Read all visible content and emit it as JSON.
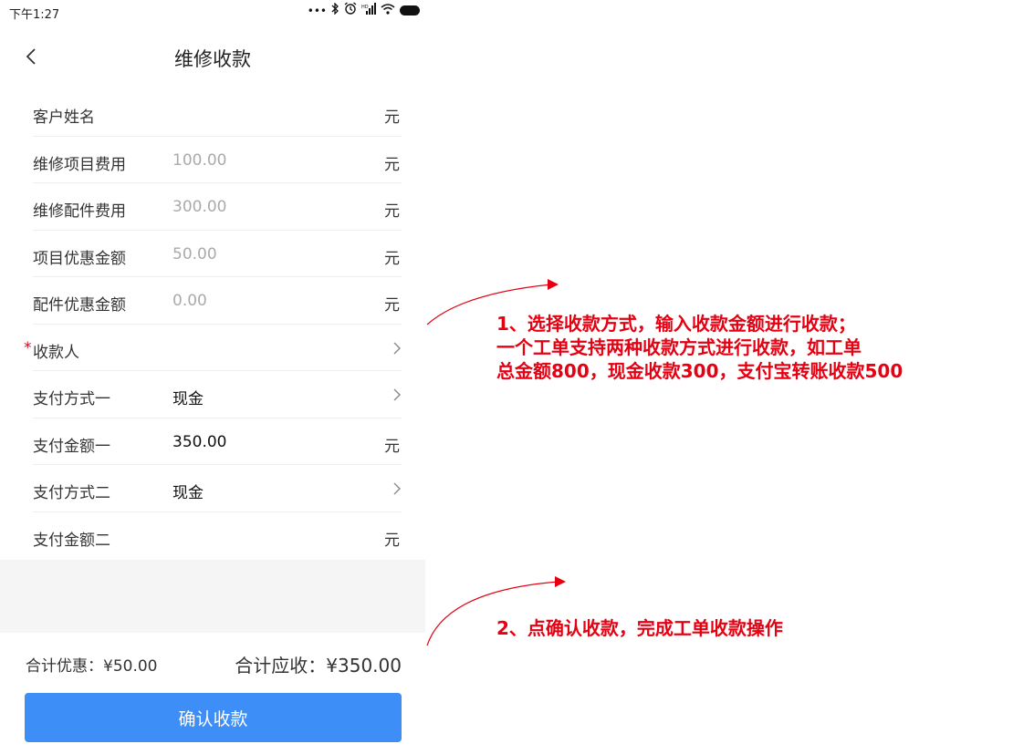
{
  "status_bar": {
    "time": "下午1:27",
    "icons": [
      "more-dots-icon",
      "bluetooth-icon",
      "alarm-icon",
      "hd-signal-icon",
      "wifi-icon",
      "battery-icon"
    ]
  },
  "nav": {
    "title": "维修收款",
    "back_icon": "chevron-left-icon"
  },
  "form": {
    "rows": [
      {
        "label": "客户姓名",
        "value": "",
        "unit": "元"
      },
      {
        "label": "维修项目费用",
        "value": "100.00",
        "unit": "元"
      },
      {
        "label": "维修配件费用",
        "value": "300.00",
        "unit": "元"
      },
      {
        "label": "项目优惠金额",
        "value": "50.00",
        "unit": "元"
      },
      {
        "label": "配件优惠金额",
        "value": "0.00",
        "unit": "元"
      },
      {
        "label": "收款人",
        "required_mark": "*",
        "value": "",
        "chevron": true
      },
      {
        "label": "支付方式一",
        "value": "现金",
        "chevron": true
      },
      {
        "label": "支付金额一",
        "value": "350.00",
        "unit": "元"
      },
      {
        "label": "支付方式二",
        "value": "现金",
        "chevron": true
      },
      {
        "label": "支付金额二",
        "value": "",
        "unit": "元"
      }
    ]
  },
  "totals": {
    "discount": "合计优惠：¥50.00",
    "receivable": "合计应收：¥350.00"
  },
  "confirm_button": {
    "label": "确认收款",
    "color": "#3e8ef7"
  },
  "annotations": {
    "color": "#e60012",
    "note1": [
      "1、选择收款方式，输入收款金额进行收款；",
      "一个工单支持两种收款方式进行收款，如工单",
      "总金额800，现金收款300，支付宝转账收款500"
    ],
    "note2": "2、点确认收款，完成工单收款操作"
  }
}
